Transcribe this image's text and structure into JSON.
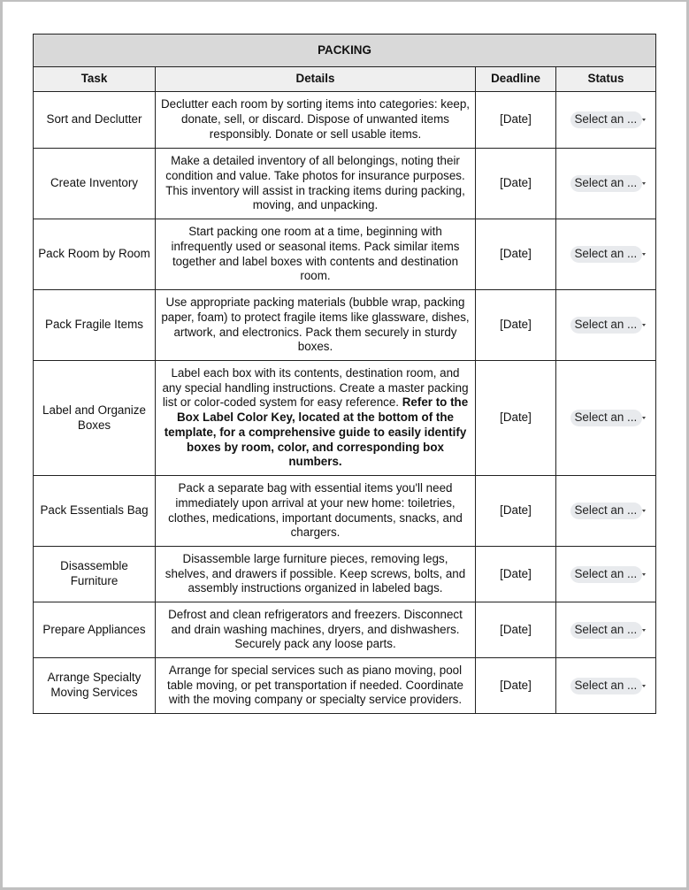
{
  "table": {
    "title": "PACKING",
    "headers": {
      "task": "Task",
      "details": "Details",
      "deadline": "Deadline",
      "status": "Status"
    },
    "rows": [
      {
        "task": "Sort and Declutter",
        "details": "Declutter each room by sorting items into categories: keep, donate, sell, or discard. Dispose of unwanted items responsibly. Donate or sell usable items.",
        "details_bold": "",
        "deadline": "[Date]",
        "status": "Select an ..."
      },
      {
        "task": "Create Inventory",
        "details": "Make a detailed inventory of all belongings, noting their condition and value. Take photos for insurance purposes. This inventory will assist in tracking items during packing, moving, and unpacking.",
        "details_bold": "",
        "deadline": "[Date]",
        "status": "Select an ..."
      },
      {
        "task": "Pack Room by Room",
        "details": "Start packing one room at a time, beginning with infrequently used or seasonal items. Pack similar items together and label boxes with contents and destination room.",
        "details_bold": "",
        "deadline": "[Date]",
        "status": "Select an ..."
      },
      {
        "task": "Pack Fragile Items",
        "details": "Use appropriate packing materials (bubble wrap, packing paper, foam) to protect fragile items like glassware, dishes, artwork, and electronics. Pack them securely in sturdy boxes.",
        "details_bold": "",
        "deadline": "[Date]",
        "status": "Select an ..."
      },
      {
        "task": "Label and Organize Boxes",
        "details": "Label each box with its contents, destination room, and any special handling instructions. Create a master packing list or color-coded system for easy reference.",
        "details_bold": "Refer to the Box Label Color Key, located at the bottom of the template, for a comprehensive guide to easily identify boxes by room, color, and corresponding box numbers.",
        "deadline": "[Date]",
        "status": "Select an ..."
      },
      {
        "task": "Pack Essentials Bag",
        "details": "Pack a separate bag with essential items you'll need immediately upon arrival at your new home: toiletries, clothes, medications, important documents, snacks, and chargers.",
        "details_bold": "",
        "deadline": "[Date]",
        "status": "Select an ..."
      },
      {
        "task": "Disassemble Furniture",
        "details": "Disassemble large furniture pieces, removing legs, shelves, and drawers if possible. Keep screws, bolts, and assembly instructions organized in labeled bags.",
        "details_bold": "",
        "deadline": "[Date]",
        "status": "Select an ..."
      },
      {
        "task": "Prepare Appliances",
        "details": "Defrost and clean refrigerators and freezers. Disconnect and drain washing machines, dryers, and dishwashers. Securely pack any loose parts.",
        "details_bold": "",
        "deadline": "[Date]",
        "status": "Select an ..."
      },
      {
        "task": "Arrange Specialty Moving Services",
        "details": "Arrange for special services such as piano moving, pool table moving, or pet transportation if needed. Coordinate with the moving company or specialty service providers.",
        "details_bold": "",
        "deadline": "[Date]",
        "status": "Select an ..."
      }
    ]
  },
  "icons": {
    "status_dropdown": "caret-down-icon"
  }
}
